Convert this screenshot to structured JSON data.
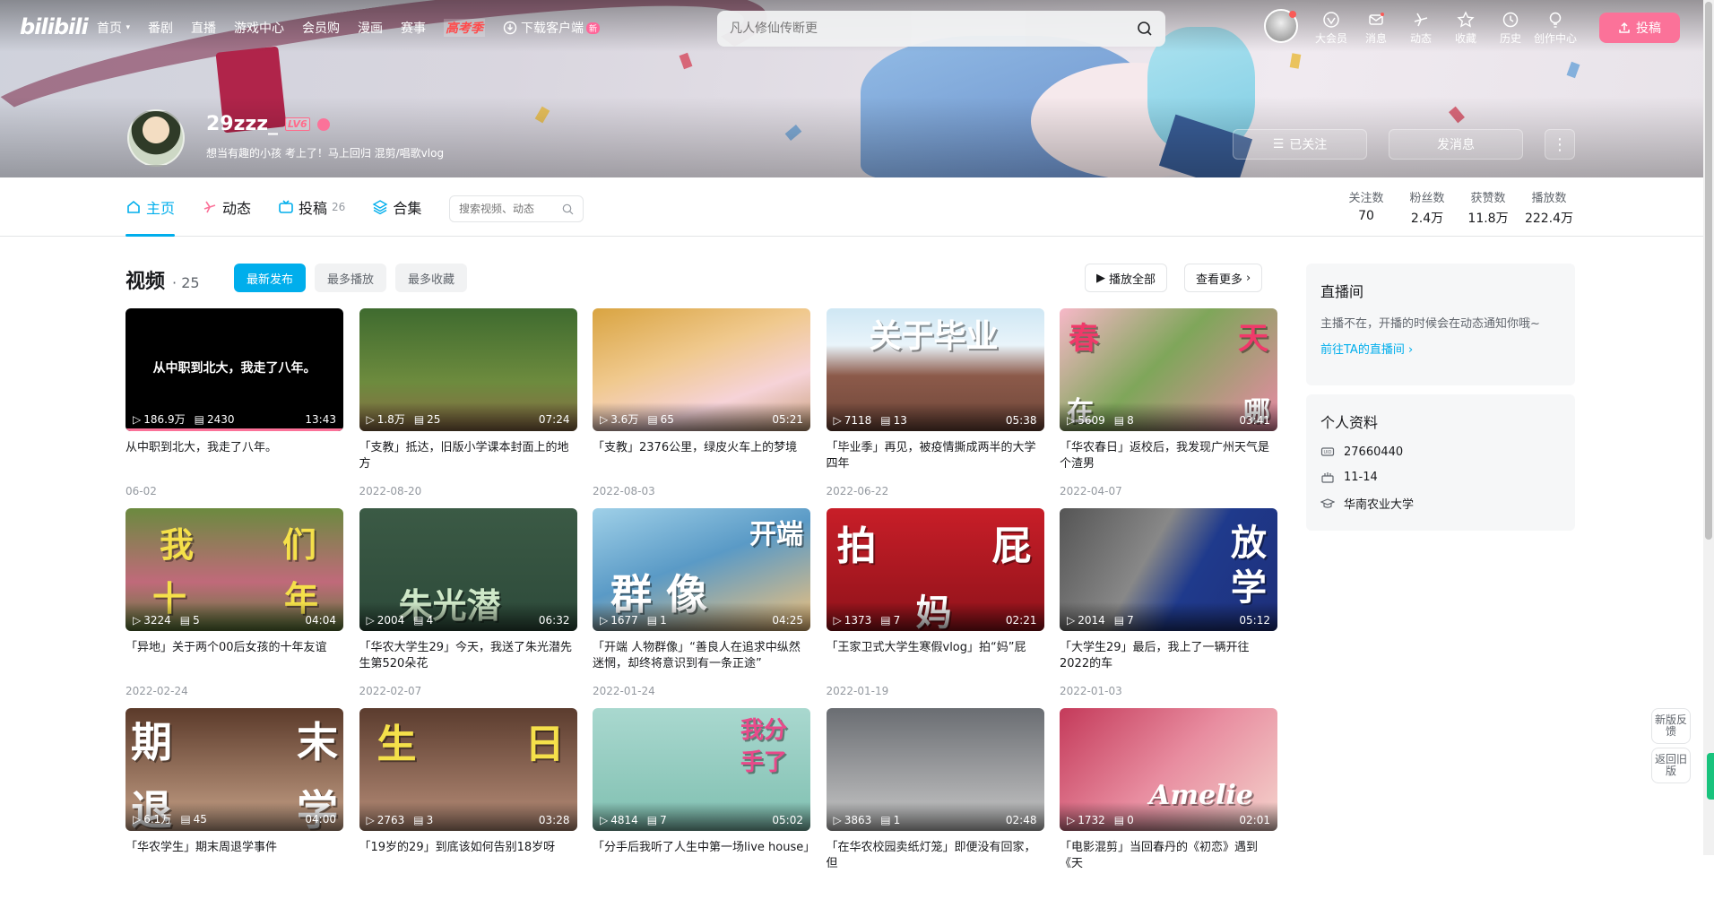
{
  "nav": {
    "logo": "bilibili",
    "links": [
      "首页",
      "番剧",
      "直播",
      "游戏中心",
      "会员购",
      "漫画",
      "赛事"
    ],
    "hot": "高考季",
    "download": "下载客户端",
    "new_badge": "新",
    "search_placeholder": "凡人修仙传断更",
    "right": [
      "大会员",
      "消息",
      "动态",
      "收藏",
      "历史",
      "创作中心"
    ],
    "upload": "投稿"
  },
  "user": {
    "name": "29zzz_",
    "level": "LV6",
    "sign": "想当有趣的小孩 考上了！马上回归 混剪/唱歌vlog",
    "follow_btn": "已关注",
    "msg_btn": "发消息",
    "more_btn": "⋮"
  },
  "tabs": [
    {
      "label": "主页",
      "count": ""
    },
    {
      "label": "动态",
      "count": ""
    },
    {
      "label": "投稿",
      "count": "26"
    },
    {
      "label": "合集",
      "count": ""
    }
  ],
  "tab_search_placeholder": "搜索视频、动态",
  "stats": [
    {
      "label": "关注数",
      "value": "70"
    },
    {
      "label": "粉丝数",
      "value": "2.4万"
    },
    {
      "label": "获赞数",
      "value": "11.8万"
    },
    {
      "label": "播放数",
      "value": "222.4万"
    }
  ],
  "videos_section": {
    "title": "视频",
    "count": "· 25",
    "sorts": [
      "最新发布",
      "最多播放",
      "最多收藏"
    ],
    "play_all": "播放全部",
    "see_more": "查看更多"
  },
  "videos": [
    {
      "views": "186.9万",
      "danmaku": "2430",
      "duration": "13:43",
      "title": "从中职到北大，我走了八年。",
      "date": "06-02",
      "thumb_text": "从中职到北大，我走了八年。"
    },
    {
      "views": "1.8万",
      "danmaku": "25",
      "duration": "07:24",
      "title": "「支教」抵达，旧版小学课本封面上的地方",
      "date": "2022-08-20",
      "thumb_text": ""
    },
    {
      "views": "3.6万",
      "danmaku": "65",
      "duration": "05:21",
      "title": "「支教」2376公里，绿皮火车上的梦境",
      "date": "2022-08-03",
      "thumb_text": ""
    },
    {
      "views": "7118",
      "danmaku": "13",
      "duration": "05:38",
      "title": "「毕业季」再见，被疫情撕成两半的大学四年",
      "date": "2022-06-22",
      "thumb_text": "关于毕业"
    },
    {
      "views": "5609",
      "danmaku": "8",
      "duration": "03:41",
      "title": "「华农春日」返校后，我发现广州天气是个渣男",
      "date": "2022-04-07",
      "thumb_text": "春 天 在 哪"
    },
    {
      "views": "3224",
      "danmaku": "5",
      "duration": "04:04",
      "title": "「异地」关于两个00后女孩的十年友谊",
      "date": "2022-02-24",
      "thumb_text": "我 们 十 年"
    },
    {
      "views": "2004",
      "danmaku": "4",
      "duration": "06:32",
      "title": "「华农大学生29」今天，我送了朱光潜先生第520朵花",
      "date": "2022-02-07",
      "thumb_text": "朱光潜"
    },
    {
      "views": "1677",
      "danmaku": "1",
      "duration": "04:25",
      "title": "「开端 人物群像」“善良人在追求中纵然迷惘，却终将意识到有一条正途”",
      "date": "2022-01-24",
      "thumb_text": "开端 群像"
    },
    {
      "views": "1373",
      "danmaku": "7",
      "duration": "02:21",
      "title": "「王家卫式大学生寒假vlog」拍“妈”屁",
      "date": "2022-01-19",
      "thumb_text": "拍 屁 妈"
    },
    {
      "views": "2014",
      "danmaku": "7",
      "duration": "05:12",
      "title": "「大学生29」最后，我上了一辆开往2022的车",
      "date": "2022-01-03",
      "thumb_text": "放 学"
    },
    {
      "views": "6.1万",
      "danmaku": "45",
      "duration": "04:00",
      "title": "「华农学生」期末周退学事件",
      "date": "",
      "thumb_text": "期 末 退 学"
    },
    {
      "views": "2763",
      "danmaku": "3",
      "duration": "03:28",
      "title": "「19岁的29」到底该如何告别18岁呀",
      "date": "",
      "thumb_text": "生 日"
    },
    {
      "views": "4814",
      "danmaku": "7",
      "duration": "05:02",
      "title": "「分手后我听了人生中第一场live house」",
      "date": "",
      "thumb_text": "我分手了"
    },
    {
      "views": "3863",
      "danmaku": "1",
      "duration": "02:48",
      "title": "「在华农校园卖纸灯笼」即便没有回家，但",
      "date": "",
      "thumb_text": ""
    },
    {
      "views": "1732",
      "danmaku": "0",
      "duration": "02:01",
      "title": "「电影混剪」当回春丹的《初恋》遇到《天",
      "date": "",
      "thumb_text": "Amelie"
    }
  ],
  "live": {
    "title": "直播间",
    "text": "主播不在，开播的时候会在动态通知你哦~",
    "link": "前往TA的直播间"
  },
  "profile": {
    "title": "个人资料",
    "uid": "27660440",
    "birthday": "11-14",
    "school": "华南农业大学"
  },
  "float": {
    "feedback": "新版反馈",
    "back": "返回旧版"
  }
}
